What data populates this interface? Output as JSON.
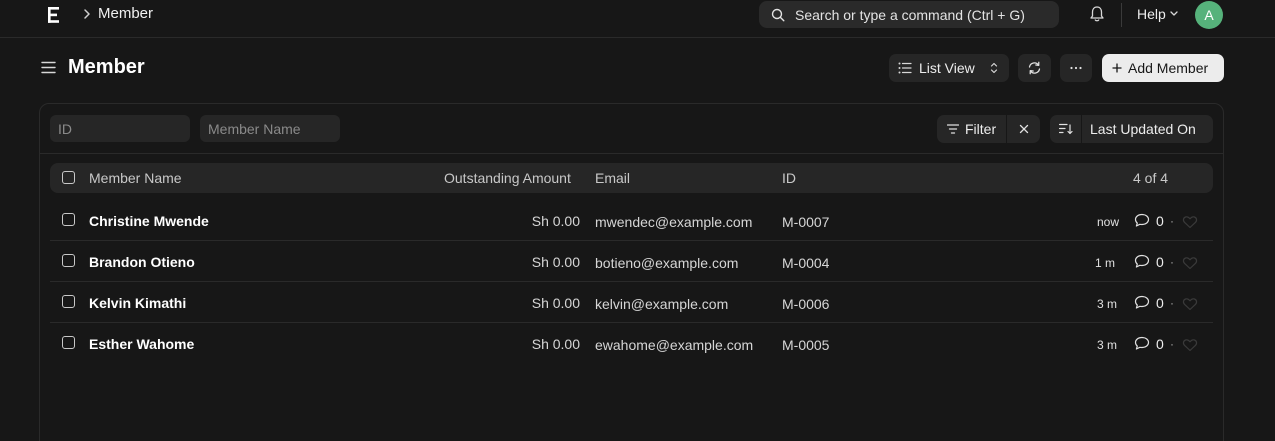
{
  "navbar": {
    "breadcrumb": "Member",
    "search_placeholder": "Search or type a command (Ctrl + G)",
    "help_label": "Help",
    "avatar_initial": "A",
    "avatar_color": "#56b27b"
  },
  "header": {
    "title": "Member",
    "list_view_label": "List View",
    "add_label": "Add Member"
  },
  "filters": {
    "id_placeholder": "ID",
    "name_placeholder": "Member Name",
    "filter_label": "Filter",
    "sort_label": "Last Updated On"
  },
  "table": {
    "columns": [
      "Member Name",
      "Outstanding Amount",
      "Email",
      "ID"
    ],
    "count_label": "4 of 4",
    "rows": [
      {
        "name": "Christine Mwende",
        "amount": "Sh 0.00",
        "email": "mwendec@example.com",
        "id": "M-0007",
        "time": "now",
        "comments": "0"
      },
      {
        "name": "Brandon Otieno",
        "amount": "Sh 0.00",
        "email": "botieno@example.com",
        "id": "M-0004",
        "time": "1 m",
        "comments": "0"
      },
      {
        "name": "Kelvin Kimathi",
        "amount": "Sh 0.00",
        "email": "kelvin@example.com",
        "id": "M-0006",
        "time": "3 m",
        "comments": "0"
      },
      {
        "name": "Esther Wahome",
        "amount": "Sh 0.00",
        "email": "ewahome@example.com",
        "id": "M-0005",
        "time": "3 m",
        "comments": "0"
      }
    ]
  },
  "icons": {
    "logo": "app-logo-icon",
    "breadcrumb_separator": "chevron-right-icon",
    "search": "search-icon",
    "notifications": "bell-icon",
    "help_dropdown": "chevron-down-icon",
    "sidebar_toggle": "hamburger-icon",
    "list_view": "list-icon",
    "list_view_switch": "sort-arrows-icon",
    "refresh": "refresh-icon",
    "more": "ellipsis-icon",
    "add": "plus-icon",
    "filter": "filter-icon",
    "clear_filter": "close-icon",
    "sort_direction": "sort-descending-icon",
    "comment": "comment-icon",
    "like": "heart-icon"
  }
}
